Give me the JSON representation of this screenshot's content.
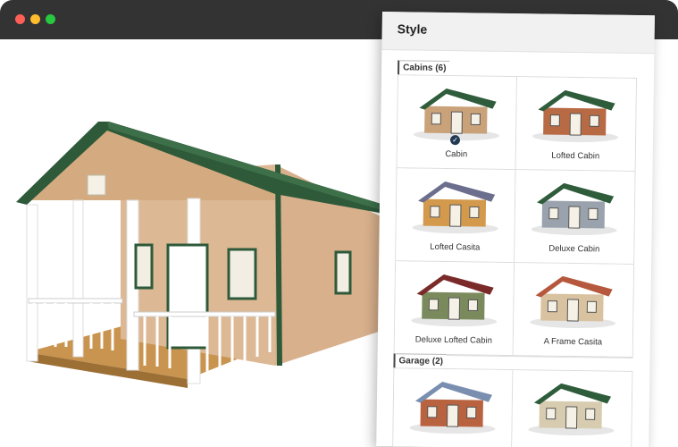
{
  "window": {
    "controls": [
      "close-icon",
      "minimize-icon",
      "zoom-icon"
    ]
  },
  "panel": {
    "title": "Style",
    "sections": [
      {
        "label": "Cabins (6)",
        "items": [
          {
            "label": "Cabin",
            "selected": true,
            "roof": "#2f5d3c",
            "wall": "#c9a27a"
          },
          {
            "label": "Lofted Cabin",
            "selected": false,
            "roof": "#2f5d3c",
            "wall": "#b86a45"
          },
          {
            "label": "Lofted Casita",
            "selected": false,
            "roof": "#6b6e8c",
            "wall": "#d39a4d"
          },
          {
            "label": "Deluxe Cabin",
            "selected": false,
            "roof": "#2f5d3c",
            "wall": "#9aa3ad"
          },
          {
            "label": "Deluxe Lofted Cabin",
            "selected": false,
            "roof": "#7b2a2a",
            "wall": "#7a8a5c"
          },
          {
            "label": "A Frame Casita",
            "selected": false,
            "roof": "#b6583e",
            "wall": "#d9c2a0"
          }
        ]
      },
      {
        "label": "Garage (2)",
        "items": [
          {
            "label": "",
            "selected": false,
            "roof": "#7a8fb0",
            "wall": "#b9623f"
          },
          {
            "label": "",
            "selected": false,
            "roof": "#2f5d3c",
            "wall": "#d7ccb0"
          }
        ]
      }
    ]
  },
  "preview": {
    "roof_color": "#2e5a3a",
    "wall_color": "#d8b08c",
    "trim_color": "#2e5a3a",
    "deck_color": "#c9944f"
  }
}
